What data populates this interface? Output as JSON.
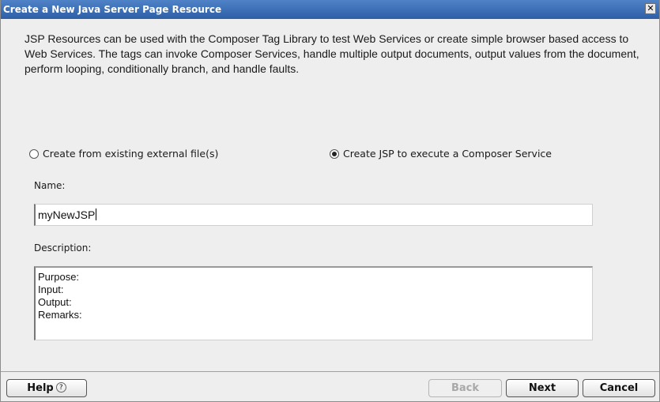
{
  "window": {
    "title": "Create a New Java Server Page Resource",
    "close_glyph": "✕"
  },
  "intro": {
    "text": "JSP Resources can be used with the Composer Tag Library to test Web Services or create simple browser based access to Web Services.  The tags can invoke Composer Services, handle multiple output documents, output values from the document, perform looping, conditionally branch, and handle faults."
  },
  "options": {
    "existing_label": "Create from existing external file(s)",
    "existing_selected": false,
    "execute_label": "Create JSP to execute a Composer Service",
    "execute_selected": true
  },
  "name_field": {
    "label": "Name:",
    "value": "myNewJSP"
  },
  "description_field": {
    "label": "Description:",
    "lines": [
      "Purpose:",
      "Input:",
      "Output:",
      "Remarks:"
    ]
  },
  "buttons": {
    "help": "Help",
    "help_icon": "?",
    "back": "Back",
    "next": "Next",
    "cancel": "Cancel"
  }
}
